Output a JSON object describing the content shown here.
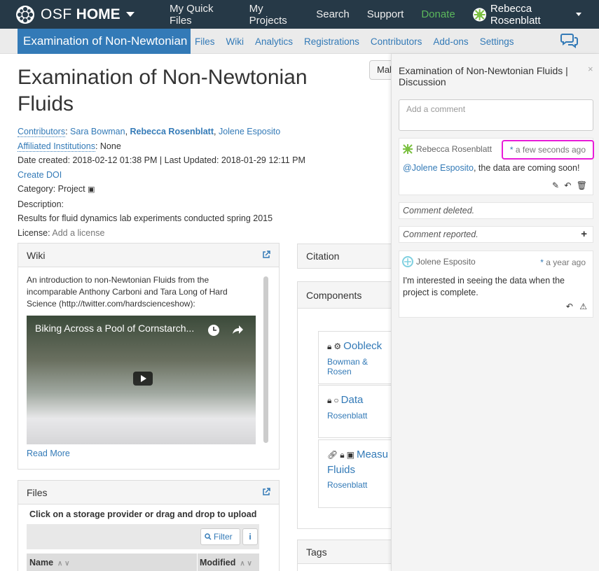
{
  "topnav": {
    "brand_osf": "OSF",
    "brand_home": "HOME",
    "items": [
      "My Quick Files",
      "My Projects",
      "Search",
      "Support",
      "Donate"
    ],
    "user": "Rebecca Rosenblatt",
    "brand_color": "#263947",
    "donate_color": "#5cb85c"
  },
  "projnav": {
    "title": "Examination of Non-Newtonian Fluids",
    "tabs": [
      "Files",
      "Wiki",
      "Analytics",
      "Registrations",
      "Contributors",
      "Add-ons",
      "Settings"
    ],
    "accent": "#337ab7"
  },
  "project": {
    "make_button": "Mak",
    "title": "Examination of Non-Newtonian Fluids",
    "contributors_label": "Contributors",
    "contributors": [
      "Sara Bowman",
      "Rebecca Rosenblatt",
      "Jolene Esposito"
    ],
    "affiliated_label": "Affiliated Institutions",
    "affiliated_value": "None",
    "dates": "Date created: 2018-02-12 01:38 PM | Last Updated: 2018-01-29 12:11 PM",
    "create_doi": "Create DOI",
    "category": "Category: Project",
    "description_label": "Description:",
    "description": "Results for fluid dynamics lab experiments conducted spring 2015",
    "license_label": "License:",
    "license_value": "Add a license"
  },
  "wiki": {
    "heading": "Wiki",
    "text": "An introduction to non-Newtonian Fluids from the incomparable Anthony Carboni and Tara Long of Hard Science (http://twitter.com/hardscienceshow):",
    "video_title": "Biking Across a Pool of Cornstarch...",
    "read_more": "Read More"
  },
  "files": {
    "heading": "Files",
    "hint": "Click on a storage provider or drag and drop to upload",
    "filter": "Filter",
    "info": "i",
    "col_name": "Name",
    "col_modified": "Modified"
  },
  "citation": {
    "heading": "Citation"
  },
  "components": {
    "heading": "Components",
    "items": [
      {
        "name": "Oobleck",
        "by": "Bowman & Rosen"
      },
      {
        "name": "Data",
        "by": "Rosenblatt"
      },
      {
        "name": "Measu",
        "name2": "Fluids",
        "by": "Rosenblatt"
      }
    ]
  },
  "tags": {
    "heading": "Tags"
  },
  "discussion": {
    "title": "Examination of Non-Newtonian Fluids | Discussion",
    "close": "×",
    "placeholder": "Add a comment",
    "comments": [
      {
        "author": "Rebecca Rosenblatt",
        "when": "a few seconds ago",
        "mention": "@Jolene Esposito",
        "text": ", the data are coming soon!"
      },
      {
        "deleted": "Comment deleted."
      },
      {
        "reported": "Comment reported.",
        "plus": "+"
      },
      {
        "author": "Jolene Esposito",
        "when": "a year ago",
        "text": "I'm interested in seeing the data when the project is complete."
      }
    ],
    "highlight_color": "#e81cd8"
  }
}
